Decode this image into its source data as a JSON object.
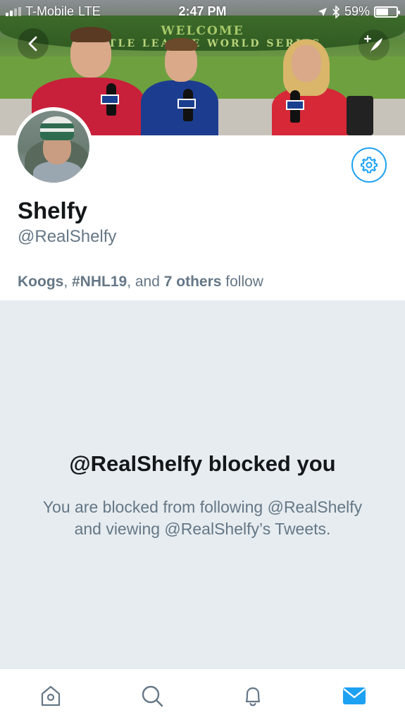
{
  "status_bar": {
    "carrier": "T-Mobile",
    "network": "LTE",
    "time": "2:47 PM",
    "battery": "59%",
    "battery_level": 0.59
  },
  "header": {
    "banner_line1": "WELCOME",
    "banner_line2": "LITTLE LEAGUE WORLD SERIES",
    "back_icon": "chevron-left-icon",
    "compose_icon": "compose-feather-icon"
  },
  "profile": {
    "display_name": "Shelfy",
    "handle": "@RealShelfy",
    "settings_icon": "gear-icon",
    "followed_by": {
      "name1": "Koogs",
      "sep1": ", ",
      "name2": "#NHL19",
      "sep2": ", and ",
      "others": "7 others",
      "suffix": " follow"
    }
  },
  "blocked": {
    "title": "@RealShelfy blocked you",
    "description": "You are blocked from following @RealShelfy and viewing @RealShelfy’s Tweets."
  },
  "tab_bar": {
    "tabs": [
      {
        "icon": "home-icon",
        "active": false
      },
      {
        "icon": "search-icon",
        "active": false
      },
      {
        "icon": "bell-icon",
        "active": false
      },
      {
        "icon": "mail-icon",
        "active": true
      }
    ]
  },
  "colors": {
    "accent": "#1da1f2",
    "muted_text": "#657786",
    "panel_bg": "#e6ecf0"
  }
}
